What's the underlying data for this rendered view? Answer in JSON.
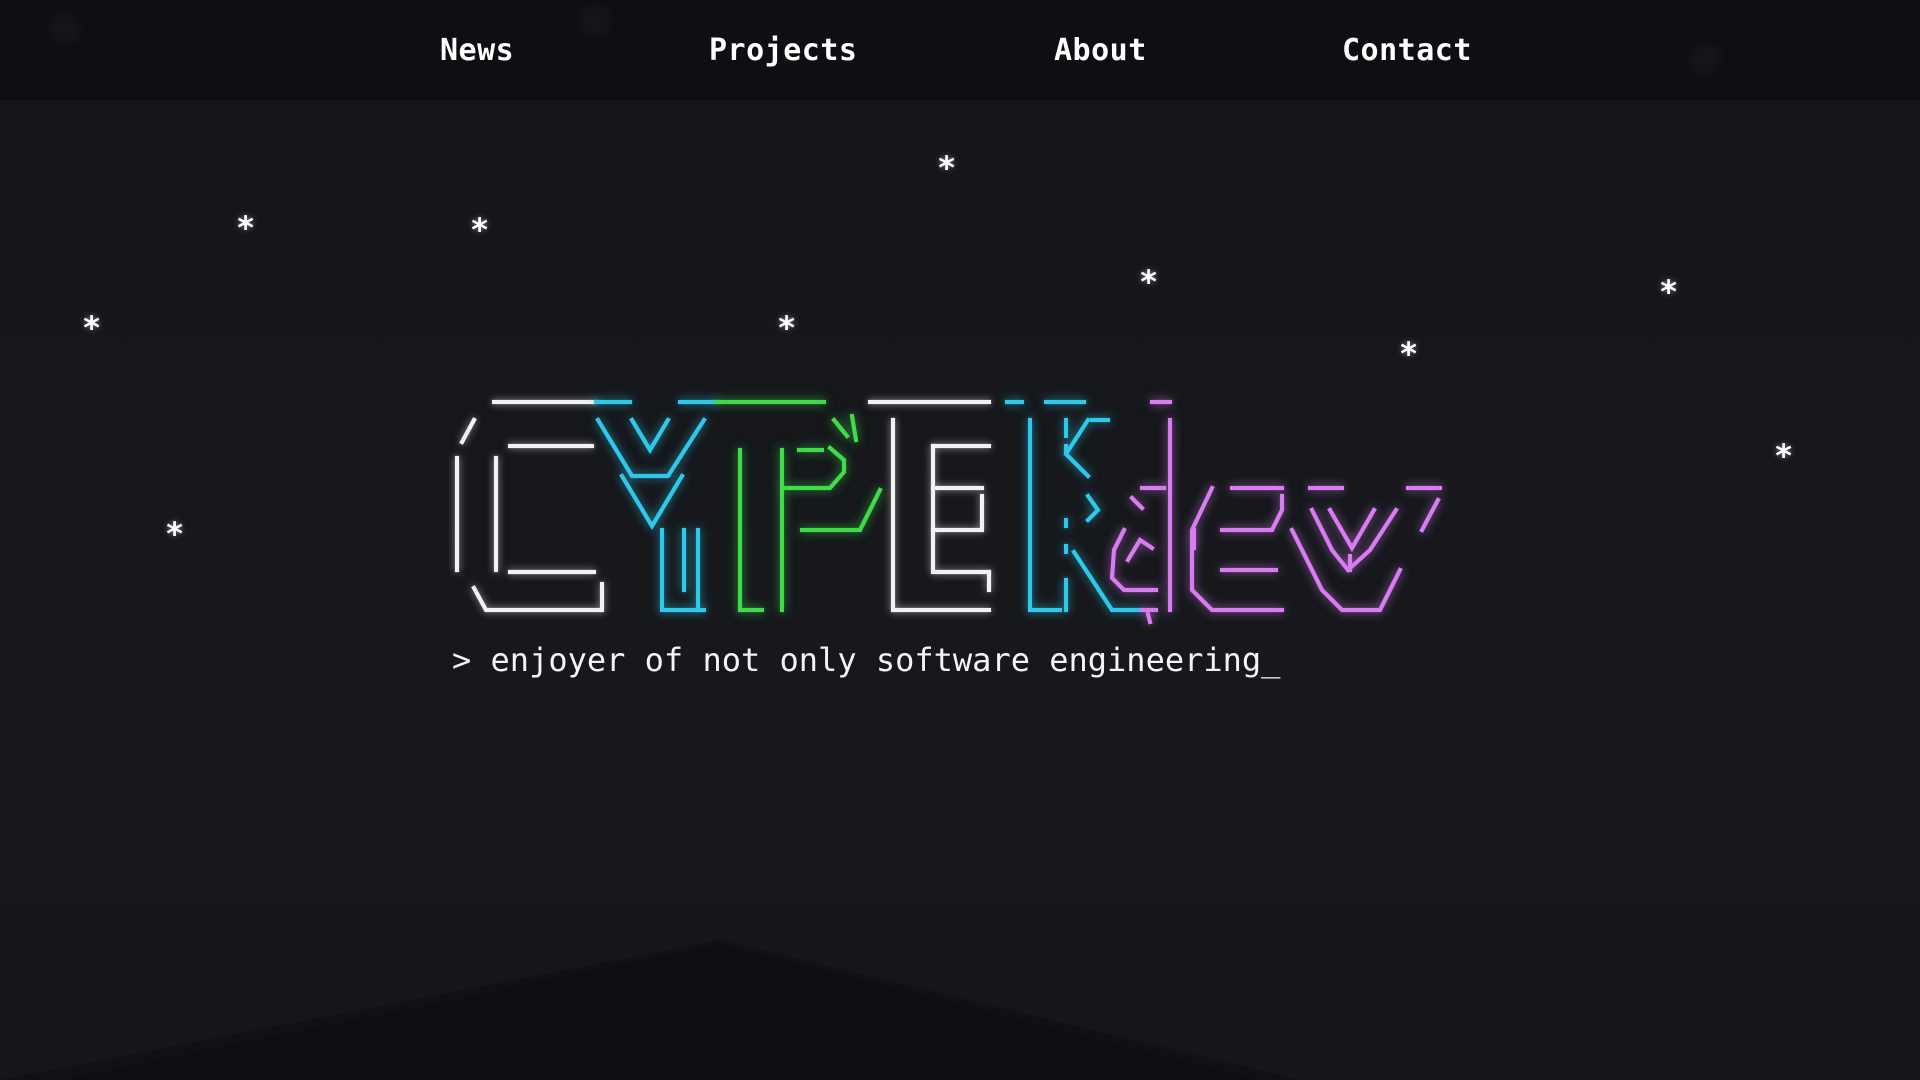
{
  "nav": {
    "items": [
      {
        "label": "News"
      },
      {
        "label": "Projects"
      },
      {
        "label": "About"
      },
      {
        "label": "Contact"
      }
    ]
  },
  "hero": {
    "logo_text": "CYPEKdev",
    "logo_colors": {
      "white": "#f2f2f2",
      "cyan": "#2ec8ea",
      "green": "#3fdc4a",
      "purple": "#d77df0"
    },
    "prompt_symbol": ">",
    "tagline": "enjoyer of not only software engineering_"
  },
  "decor": {
    "star_glyph": "*"
  },
  "theme": {
    "background": "#121418",
    "text": "#ffffff"
  }
}
